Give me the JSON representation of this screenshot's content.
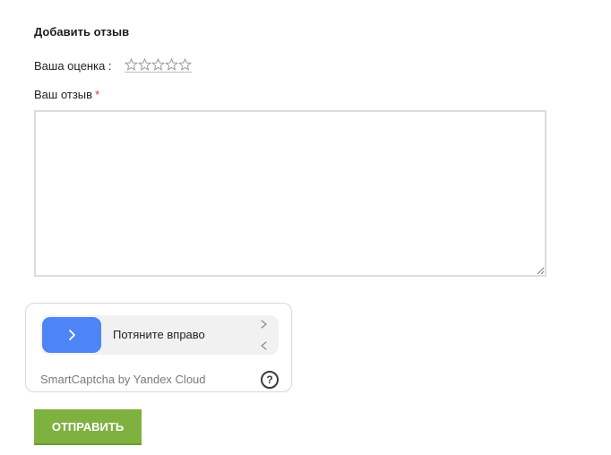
{
  "form": {
    "title": "Добавить отзыв",
    "rating_label": "Ваша оценка :",
    "rating_value": 0,
    "rating_max": 5,
    "review_label": "Ваш отзыв",
    "required_mark": "*",
    "review_value": ""
  },
  "captcha": {
    "instruction": "Потяните вправо",
    "brand": "SmartCaptcha by Yandex Cloud",
    "help_glyph": "?",
    "handle_icon": "chevron-right-icon",
    "accent_color": "#4d84f6"
  },
  "submit": {
    "label": "ОТПРАВИТЬ",
    "color": "#7fb141"
  }
}
